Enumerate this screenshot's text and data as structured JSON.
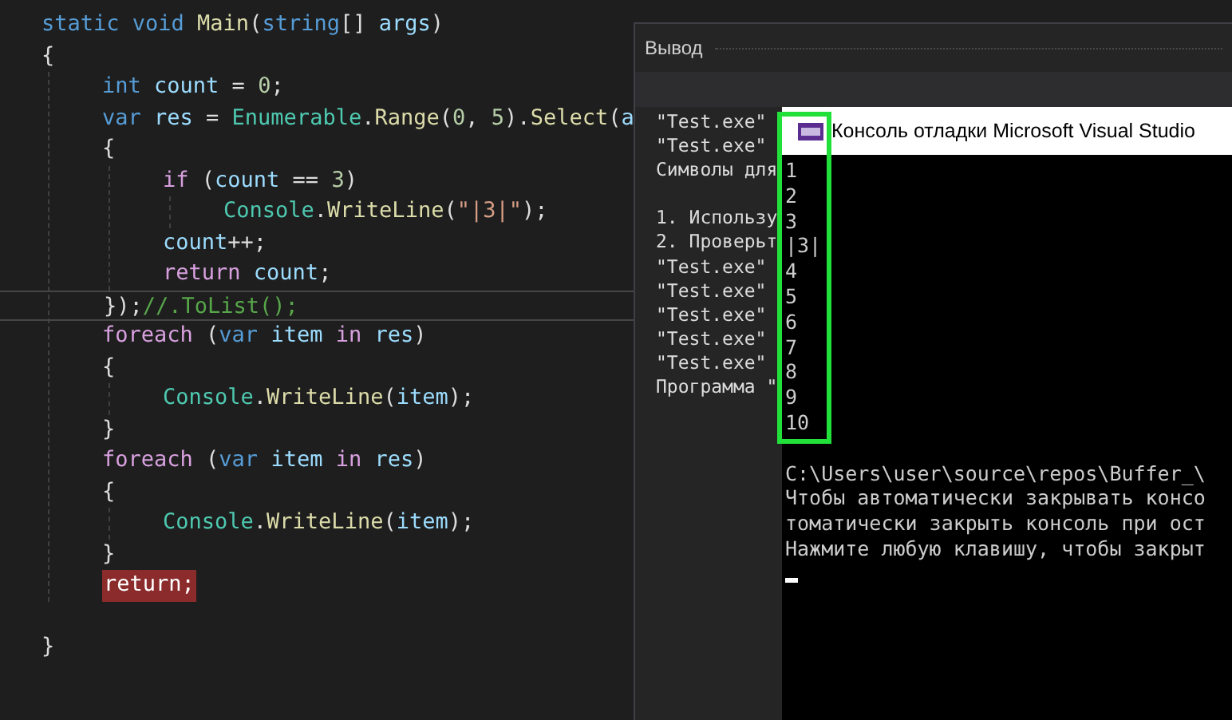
{
  "editor": {
    "lines": [
      {
        "tokens": [
          {
            "text": "static",
            "kind": "keyword"
          },
          {
            "text": " void",
            "kind": "keyword"
          },
          {
            "text": " Main",
            "kind": "method"
          },
          {
            "text": "(",
            "kind": "plain"
          },
          {
            "text": "string",
            "kind": "keyword"
          },
          {
            "text": "[] ",
            "kind": "plain"
          },
          {
            "text": "args",
            "kind": "var"
          },
          {
            "text": ")",
            "kind": "plain"
          }
        ]
      },
      {
        "tokens": [
          {
            "text": "{",
            "kind": "plain"
          }
        ],
        "children": [
          {
            "tokens": [
              {
                "text": "int",
                "kind": "keyword"
              },
              {
                "text": " count",
                "kind": "var"
              },
              {
                "text": " = ",
                "kind": "plain"
              },
              {
                "text": "0",
                "kind": "number"
              },
              {
                "text": ";",
                "kind": "plain"
              }
            ]
          },
          {
            "tokens": [
              {
                "text": "var",
                "kind": "keyword"
              },
              {
                "text": " res",
                "kind": "var"
              },
              {
                "text": " = ",
                "kind": "plain"
              },
              {
                "text": "Enumerable",
                "kind": "type"
              },
              {
                "text": ".",
                "kind": "plain"
              },
              {
                "text": "Range",
                "kind": "method"
              },
              {
                "text": "(",
                "kind": "plain"
              },
              {
                "text": "0",
                "kind": "number"
              },
              {
                "text": ", ",
                "kind": "plain"
              },
              {
                "text": "5",
                "kind": "number"
              },
              {
                "text": ").",
                "kind": "plain"
              },
              {
                "text": "Select",
                "kind": "method"
              },
              {
                "text": "(",
                "kind": "plain"
              },
              {
                "text": "a",
                "kind": "var"
              }
            ]
          },
          {
            "tokens": [
              {
                "text": "{",
                "kind": "plain"
              }
            ],
            "children": [
              {
                "tokens": [
                  {
                    "text": "if",
                    "kind": "control"
                  },
                  {
                    "text": " (",
                    "kind": "plain"
                  },
                  {
                    "text": "count",
                    "kind": "var"
                  },
                  {
                    "text": " == ",
                    "kind": "plain"
                  },
                  {
                    "text": "3",
                    "kind": "number"
                  },
                  {
                    "text": ")",
                    "kind": "plain"
                  }
                ],
                "children": [
                  {
                    "tokens": [
                      {
                        "text": "Console",
                        "kind": "type"
                      },
                      {
                        "text": ".",
                        "kind": "plain"
                      },
                      {
                        "text": "WriteLine",
                        "kind": "method"
                      },
                      {
                        "text": "(",
                        "kind": "plain"
                      },
                      {
                        "text": "\"|3|\"",
                        "kind": "string"
                      },
                      {
                        "text": ");",
                        "kind": "plain"
                      }
                    ]
                  }
                ]
              },
              {
                "tokens": [
                  {
                    "text": "count",
                    "kind": "var"
                  },
                  {
                    "text": "++;",
                    "kind": "plain"
                  }
                ]
              },
              {
                "tokens": [
                  {
                    "text": "return",
                    "kind": "control"
                  },
                  {
                    "text": " count",
                    "kind": "var"
                  },
                  {
                    "text": ";",
                    "kind": "plain"
                  }
                ]
              }
            ]
          },
          {
            "tokens": [
              {
                "text": "});",
                "kind": "plain"
              },
              {
                "text": "//.ToList();",
                "kind": "comment"
              }
            ],
            "current_line": true
          },
          {
            "tokens": [
              {
                "text": "foreach",
                "kind": "control"
              },
              {
                "text": " (",
                "kind": "plain"
              },
              {
                "text": "var",
                "kind": "keyword"
              },
              {
                "text": " item",
                "kind": "var"
              },
              {
                "text": " in",
                "kind": "control"
              },
              {
                "text": " res",
                "kind": "var"
              },
              {
                "text": ")",
                "kind": "plain"
              }
            ]
          },
          {
            "tokens": [
              {
                "text": "{",
                "kind": "plain"
              }
            ],
            "children": [
              {
                "tokens": [
                  {
                    "text": "Console",
                    "kind": "type"
                  },
                  {
                    "text": ".",
                    "kind": "plain"
                  },
                  {
                    "text": "WriteLine",
                    "kind": "method"
                  },
                  {
                    "text": "(",
                    "kind": "plain"
                  },
                  {
                    "text": "item",
                    "kind": "var"
                  },
                  {
                    "text": ");",
                    "kind": "plain"
                  }
                ]
              }
            ]
          },
          {
            "tokens": [
              {
                "text": "}",
                "kind": "plain"
              }
            ]
          },
          {
            "tokens": [
              {
                "text": "foreach",
                "kind": "control"
              },
              {
                "text": " (",
                "kind": "plain"
              },
              {
                "text": "var",
                "kind": "keyword"
              },
              {
                "text": " item",
                "kind": "var"
              },
              {
                "text": " in",
                "kind": "control"
              },
              {
                "text": " res",
                "kind": "var"
              },
              {
                "text": ")",
                "kind": "plain"
              }
            ]
          },
          {
            "tokens": [
              {
                "text": "{",
                "kind": "plain"
              }
            ],
            "children": [
              {
                "tokens": [
                  {
                    "text": "Console",
                    "kind": "type"
                  },
                  {
                    "text": ".",
                    "kind": "plain"
                  },
                  {
                    "text": "WriteLine",
                    "kind": "method"
                  },
                  {
                    "text": "(",
                    "kind": "plain"
                  },
                  {
                    "text": "item",
                    "kind": "var"
                  },
                  {
                    "text": ");",
                    "kind": "plain"
                  }
                ]
              }
            ]
          },
          {
            "tokens": [
              {
                "text": "}",
                "kind": "plain"
              }
            ]
          },
          {
            "tokens": [
              {
                "text": "return;",
                "kind": "control"
              }
            ],
            "breakpoint": true
          }
        ]
      },
      {
        "tokens": [
          {
            "text": "}",
            "kind": "plain"
          }
        ]
      }
    ]
  },
  "output_panel": {
    "title": "Вывод",
    "paragraphs": [
      [
        "\"Test.exe\"",
        "\"Test.exe\"",
        "Символы для"
      ],
      [
        "1. Использу",
        "2. Проверьт",
        "\"Test.exe\"",
        "\"Test.exe\"",
        "\"Test.exe\"",
        "\"Test.exe\"",
        "\"Test.exe\"",
        "Программа \""
      ]
    ]
  },
  "console_window": {
    "title": "Консоль отладки Microsoft Visual Studio",
    "paragraphs": [
      [
        "1",
        "2",
        "3",
        "|3|",
        "4",
        "5",
        "6",
        "7",
        "8",
        "9",
        "10"
      ],
      [
        "C:\\Users\\user\\source\\repos\\Buffer_\\",
        "Чтобы автоматически закрывать консо",
        "томатически закрыть консоль при ост",
        "Нажмите любую клавишу, чтобы закрыт"
      ]
    ]
  }
}
